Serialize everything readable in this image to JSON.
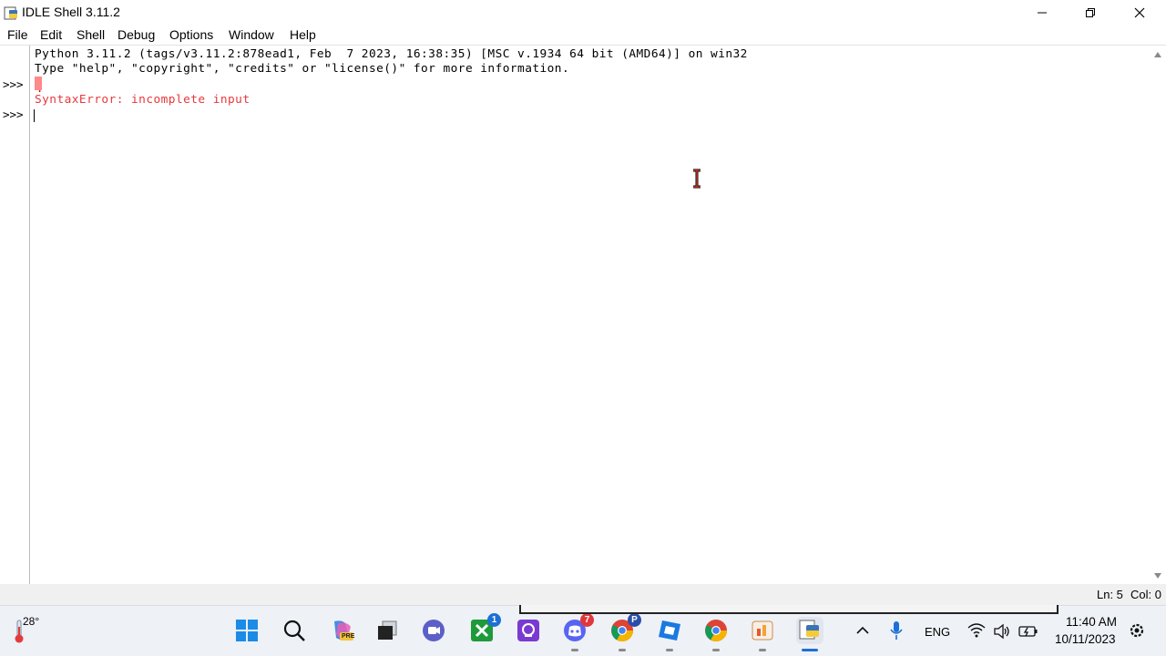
{
  "window": {
    "title": "IDLE Shell 3.11.2"
  },
  "menu": {
    "items": [
      "File",
      "Edit",
      "Shell",
      "Debug",
      "Options",
      "Window",
      "Help"
    ]
  },
  "shell": {
    "prompt": ">>>",
    "banner_line1": "Python 3.11.2 (tags/v3.11.2:878ead1, Feb  7 2023, 16:38:35) [MSC v.1934 64 bit (AMD64)] on win32",
    "banner_line2": "Type \"help\", \"copyright\", \"credits\" or \"license()\" for more information.",
    "input_line": ".",
    "error_line": "SyntaxError: incomplete input",
    "error_color": "#e8373c"
  },
  "status": {
    "line": "Ln: 5",
    "col": "Col: 0"
  },
  "taskbar": {
    "weather_temp": "28°",
    "icons": [
      {
        "name": "windows-start-icon"
      },
      {
        "name": "search-icon"
      },
      {
        "name": "copilot-icon",
        "label": "PRE"
      },
      {
        "name": "task-view-icon"
      },
      {
        "name": "teams-icon"
      },
      {
        "name": "xbox-icon",
        "badge": "1"
      },
      {
        "name": "app-icon"
      },
      {
        "name": "discord-icon",
        "badge": "7"
      },
      {
        "name": "chrome-profile-icon",
        "badge": "P"
      },
      {
        "name": "roblox-studio-icon"
      },
      {
        "name": "chrome-icon"
      },
      {
        "name": "paint-app-icon"
      },
      {
        "name": "python-idle-icon"
      }
    ],
    "tray": {
      "language": "ENG",
      "time": "11:40 AM",
      "date": "10/11/2023"
    }
  }
}
